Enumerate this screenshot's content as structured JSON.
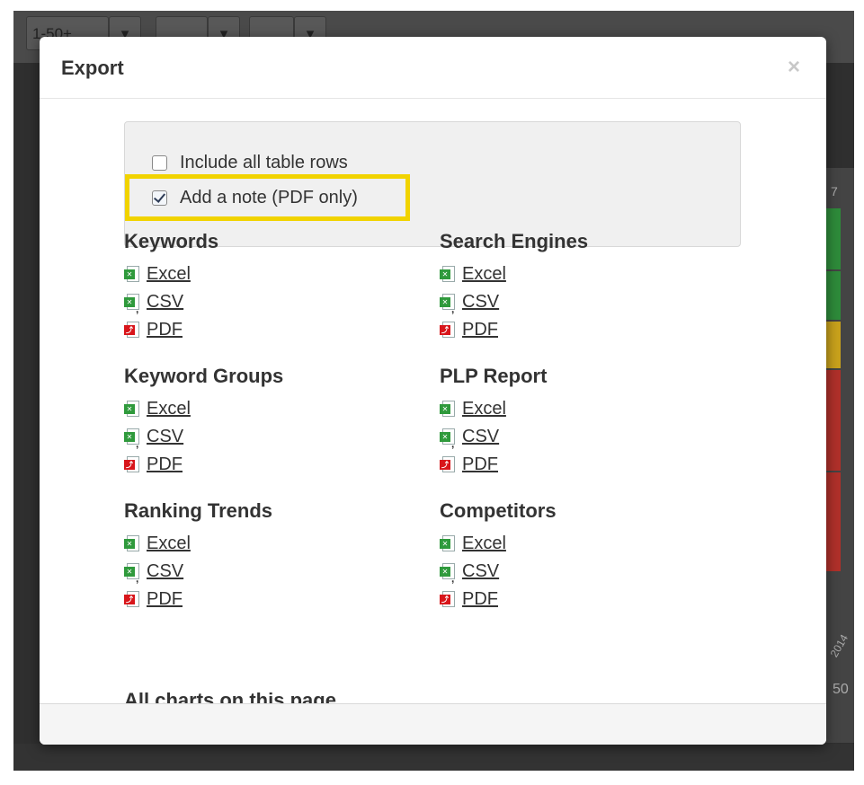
{
  "background": {
    "pager_label": "1-50+",
    "right_labels": [
      "7",
      "2014",
      "50"
    ],
    "bar_colors": [
      "#2e8b3a",
      "#2e8b3a",
      "#c9a21c",
      "#b0302a",
      "#b0302a"
    ]
  },
  "modal": {
    "title": "Export",
    "close_glyph": "×",
    "options": [
      {
        "label": "Include all table rows",
        "checked": false
      },
      {
        "label": "Add a note (PDF only)",
        "checked": true
      }
    ],
    "sections": [
      {
        "title": "Keywords",
        "links": [
          {
            "label": "Excel",
            "icon": "excel-file-icon"
          },
          {
            "label": "CSV",
            "icon": "csv-file-icon"
          },
          {
            "label": "PDF",
            "icon": "pdf-file-icon"
          }
        ]
      },
      {
        "title": "Search Engines",
        "links": [
          {
            "label": "Excel",
            "icon": "excel-file-icon"
          },
          {
            "label": "CSV",
            "icon": "csv-file-icon"
          },
          {
            "label": "PDF",
            "icon": "pdf-file-icon"
          }
        ]
      },
      {
        "title": "Keyword Groups",
        "links": [
          {
            "label": "Excel",
            "icon": "excel-file-icon"
          },
          {
            "label": "CSV",
            "icon": "csv-file-icon"
          },
          {
            "label": "PDF",
            "icon": "pdf-file-icon"
          }
        ]
      },
      {
        "title": "PLP Report",
        "links": [
          {
            "label": "Excel",
            "icon": "excel-file-icon"
          },
          {
            "label": "CSV",
            "icon": "csv-file-icon"
          },
          {
            "label": "PDF",
            "icon": "pdf-file-icon"
          }
        ]
      },
      {
        "title": "Ranking Trends",
        "links": [
          {
            "label": "Excel",
            "icon": "excel-file-icon"
          },
          {
            "label": "CSV",
            "icon": "csv-file-icon"
          },
          {
            "label": "PDF",
            "icon": "pdf-file-icon"
          }
        ]
      },
      {
        "title": "Competitors",
        "links": [
          {
            "label": "Excel",
            "icon": "excel-file-icon"
          },
          {
            "label": "CSV",
            "icon": "csv-file-icon"
          },
          {
            "label": "PDF",
            "icon": "pdf-file-icon"
          }
        ]
      }
    ],
    "cut_off_section_title": "All charts on this page",
    "highlight_color": "#f1d300"
  }
}
